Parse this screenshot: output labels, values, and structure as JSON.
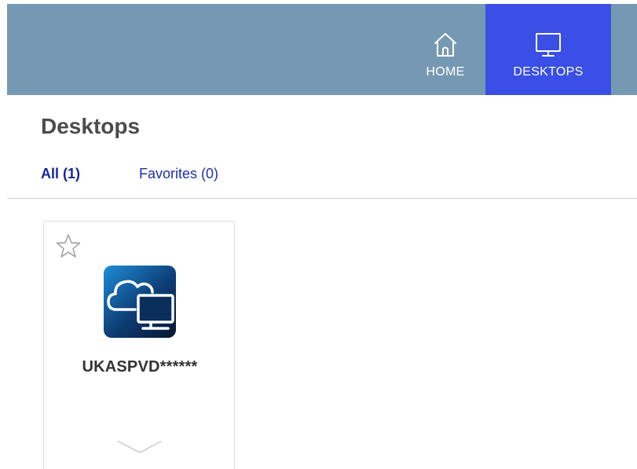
{
  "nav": {
    "home_label": "HOME",
    "desktops_label": "DESKTOPS",
    "home_icon": "home-icon",
    "desktops_icon": "monitor-icon",
    "active": "desktops",
    "bar_color": "#7699b3",
    "active_color": "#3a4fe6"
  },
  "page": {
    "title": "Desktops"
  },
  "tabs": [
    {
      "label": "All (1)",
      "active": true
    },
    {
      "label": "Favorites (0)",
      "active": false
    }
  ],
  "desktops": [
    {
      "name": "UKASPVD******",
      "icon": "cloud-desktop-icon",
      "favorite": false,
      "favorite_icon": "star-outline-icon",
      "expand_icon": "chevron-down-icon"
    }
  ]
}
